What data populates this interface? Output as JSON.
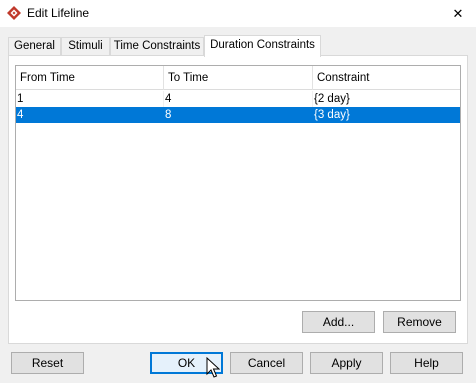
{
  "window": {
    "title": "Edit Lifeline",
    "close_symbol": "✕"
  },
  "tabs": [
    {
      "label": "General"
    },
    {
      "label": "Stimuli"
    },
    {
      "label": "Time Constraints"
    },
    {
      "label": "Duration Constraints",
      "active": true
    }
  ],
  "table": {
    "columns": [
      "From Time",
      "To Time",
      "Constraint"
    ],
    "rows": [
      {
        "from": "1",
        "to": "4",
        "constraint": "{2 day}",
        "selected": false
      },
      {
        "from": "4",
        "to": "8",
        "constraint": "{3 day}",
        "selected": true
      }
    ]
  },
  "panel_buttons": {
    "add": "Add...",
    "remove": "Remove"
  },
  "dialog_buttons": {
    "reset": "Reset",
    "ok": "OK",
    "cancel": "Cancel",
    "apply": "Apply",
    "help": "Help"
  },
  "colors": {
    "selection": "#0078d7",
    "app_icon": "#c0392b"
  }
}
